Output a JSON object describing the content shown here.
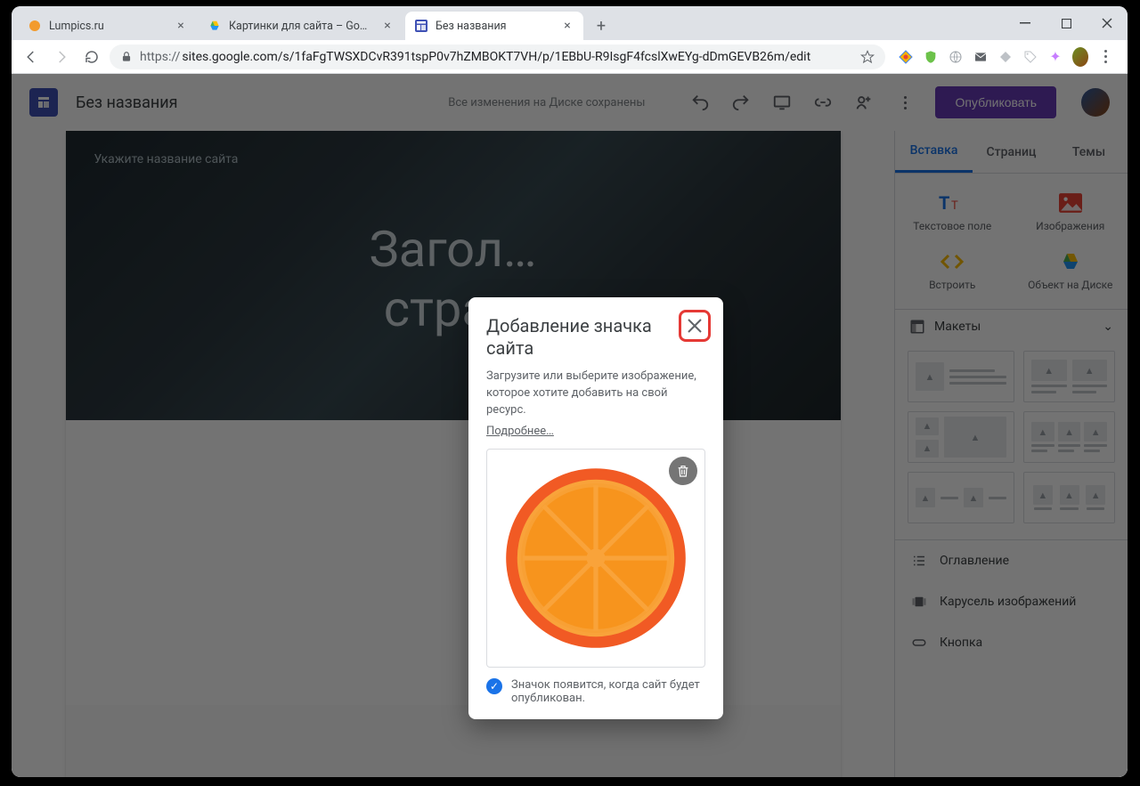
{
  "browser": {
    "tabs": [
      {
        "title": "Lumpics.ru",
        "active": false,
        "favicon": "orange-dot"
      },
      {
        "title": "Картинки для сайта – Google Д…",
        "active": false,
        "favicon": "drive"
      },
      {
        "title": "Без названия",
        "active": true,
        "favicon": "sites"
      }
    ],
    "url_proto": "https://",
    "url_rest": "sites.google.com/s/1faFgTWSXDCvR391tspP0v7hZMBOKT7VH/p/1EBbU-R9IsgF4fcslXwEYg-dDmGEVB26m/edit"
  },
  "app": {
    "doc_title": "Без названия",
    "save_status": "Все изменения на Диске сохранены",
    "publish_label": "Опубликовать",
    "hero_label": "Укажите название сайта",
    "hero_title": "Загол…\nстра…",
    "side_tabs": {
      "insert": "Вставка",
      "pages": "Страниц",
      "themes": "Темы"
    },
    "insert_items": {
      "textbox": "Текстовое поле",
      "images": "Изображения",
      "embed": "Встроить",
      "drive": "Объект на Диске"
    },
    "layouts_label": "Макеты",
    "side_list": {
      "toc": "Оглавление",
      "carousel": "Карусель изображений",
      "button": "Кнопка"
    }
  },
  "dialog": {
    "title": "Добавление значка сайта",
    "desc": "Загрузите или выберите изображение, которое хотите добавить на свой ресурс.",
    "more": "Подробнее…",
    "note": "Значок появится, когда сайт будет опубликован."
  }
}
